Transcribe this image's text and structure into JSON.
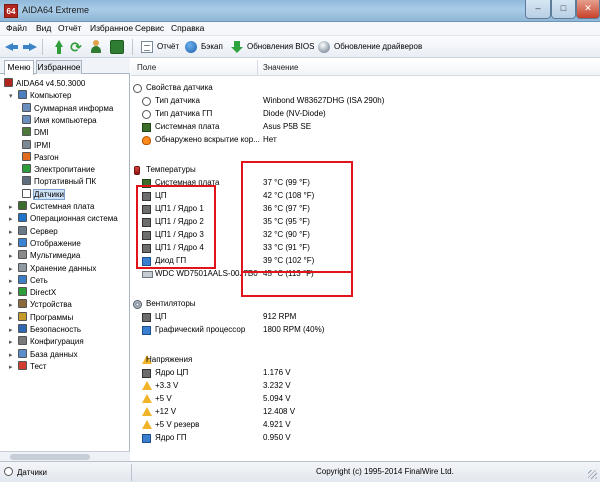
{
  "window": {
    "title": "AIDA64 Extreme",
    "app_icon_text": "64"
  },
  "menu": [
    "Файл",
    "Вид",
    "Отчёт",
    "Избранное",
    "Сервис",
    "Справка"
  ],
  "toolbar": {
    "report_label": "Отчёт",
    "benchmark_label": "Бэкап",
    "bios_label": "Обновления BIOS",
    "drivers_label": "Обновление драйверов"
  },
  "left_tabs": [
    "Меню",
    "Избранное"
  ],
  "tree": [
    {
      "label": "AIDA64 v4.50.3000",
      "icon_color": "#b3261e",
      "expander": ""
    },
    {
      "label": "Компьютер",
      "icon_color": "#4a7fc0",
      "expander": "▾"
    },
    {
      "label": "Суммарная информа",
      "icon_color": "#6a8fbf",
      "expander": ""
    },
    {
      "label": "Имя компьютера",
      "icon_color": "#6a8fbf",
      "expander": ""
    },
    {
      "label": "DMI",
      "icon_color": "#4d7a3a",
      "expander": ""
    },
    {
      "label": "IPMI",
      "icon_color": "#7c8a96",
      "expander": ""
    },
    {
      "label": "Разгон",
      "icon_color": "#e06a1e",
      "expander": ""
    },
    {
      "label": "Электропитание",
      "icon_color": "#2e9e3a",
      "expander": ""
    },
    {
      "label": "Портативный ПК",
      "icon_color": "#5f6e7d",
      "expander": ""
    },
    {
      "label": "Датчики",
      "icon_color": "#ffffff",
      "expander": ""
    },
    {
      "label": "Системная плата",
      "icon_color": "#3b6e2a",
      "expander": "▸"
    },
    {
      "label": "Операционная система",
      "icon_color": "#1f73c8",
      "expander": "▸"
    },
    {
      "label": "Сервер",
      "icon_color": "#6b7a89",
      "expander": "▸"
    },
    {
      "label": "Отображение",
      "icon_color": "#3a86d4",
      "expander": "▸"
    },
    {
      "label": "Мультимедиа",
      "icon_color": "#8a8a8a",
      "expander": "▸"
    },
    {
      "label": "Хранение данных",
      "icon_color": "#8f99a3",
      "expander": "▸"
    },
    {
      "label": "Сеть",
      "icon_color": "#3c7fc4",
      "expander": "▸"
    },
    {
      "label": "DirectX",
      "icon_color": "#2e9e3a",
      "expander": "▸"
    },
    {
      "label": "Устройства",
      "icon_color": "#8a6a3a",
      "expander": "▸"
    },
    {
      "label": "Программы",
      "icon_color": "#c49a2a",
      "expander": "▸"
    },
    {
      "label": "Безопасность",
      "icon_color": "#2d68b0",
      "expander": "▸"
    },
    {
      "label": "Конфигурация",
      "icon_color": "#7a7a7a",
      "expander": "▸"
    },
    {
      "label": "База данных",
      "icon_color": "#5b8fcc",
      "expander": "▸"
    },
    {
      "label": "Тест",
      "icon_color": "#d43b2f",
      "expander": "▸"
    }
  ],
  "columns": {
    "field": "Поле",
    "value": "Значение"
  },
  "sections": {
    "props": {
      "title": "Свойства датчика",
      "rows": [
        {
          "field": "Тип датчика",
          "value": "Winbond W83627DHG  (ISA 290h)"
        },
        {
          "field": "Тип датчика ГП",
          "value": "Diode  (NV-Diode)"
        },
        {
          "field": "Системная плата",
          "value": "Asus P5B SE"
        },
        {
          "field": "Обнаружено вскрытие кор...",
          "value": "Нет"
        }
      ]
    },
    "temps": {
      "title": "Температуры",
      "rows": [
        {
          "field": "Системная плата",
          "value": "37 °C  (99 °F)"
        },
        {
          "field": "ЦП",
          "value": "42 °C  (108 °F)"
        },
        {
          "field": "ЦП1 / Ядро 1",
          "value": "36 °C  (97 °F)"
        },
        {
          "field": "ЦП1 / Ядро 2",
          "value": "35 °C  (95 °F)"
        },
        {
          "field": "ЦП1 / Ядро 3",
          "value": "32 °C  (90 °F)"
        },
        {
          "field": "ЦП1 / Ядро 4",
          "value": "33 °C  (91 °F)"
        },
        {
          "field": "Диод ГП",
          "value": "39 °C  (102 °F)"
        },
        {
          "field": "WDC WD7501AALS-00J7B0",
          "value": "45 °C  (113 °F)"
        }
      ]
    },
    "fans": {
      "title": "Вентиляторы",
      "rows": [
        {
          "field": "ЦП",
          "value": "912 RPM"
        },
        {
          "field": "Графический процессор",
          "value": "1800 RPM  (40%)"
        }
      ]
    },
    "volts": {
      "title": "Напряжения",
      "rows": [
        {
          "field": "Ядро ЦП",
          "value": "1.176 V"
        },
        {
          "field": "+3.3 V",
          "value": "3.232 V"
        },
        {
          "field": "+5 V",
          "value": "5.094 V"
        },
        {
          "field": "+12 V",
          "value": "12.408 V"
        },
        {
          "field": "+5 V резерв",
          "value": "4.921 V"
        },
        {
          "field": "Ядро ГП",
          "value": "0.950 V"
        }
      ]
    }
  },
  "status": {
    "left": "Датчики",
    "right": "Copyright (c) 1995-2014 FinalWire Ltd."
  }
}
